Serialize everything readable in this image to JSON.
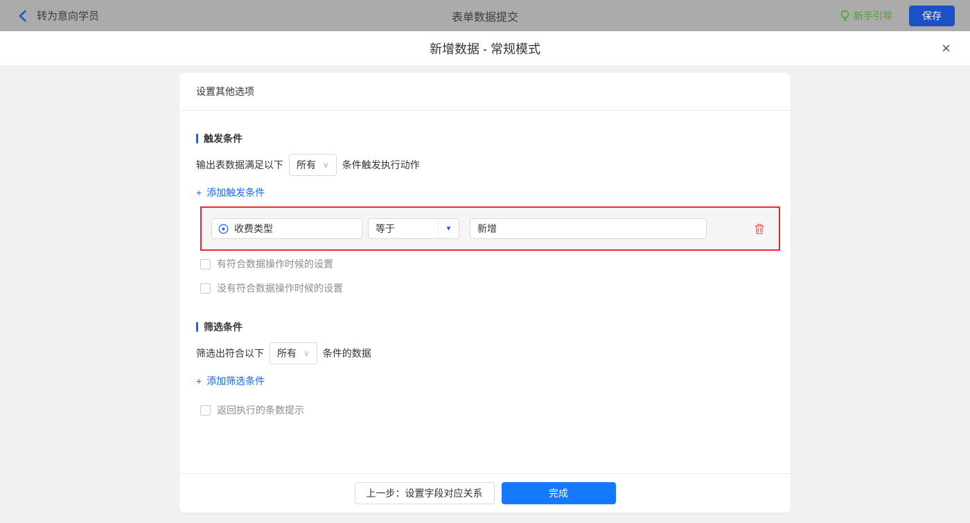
{
  "topbar": {
    "back_label": "转为意向学员",
    "title": "表单数据提交",
    "guide_label": "新手引导",
    "save_label": "保存"
  },
  "modal": {
    "title": "新增数据 - 常规模式"
  },
  "icons": {
    "close": "×",
    "plus": "+",
    "select_chevron": "∨",
    "operator_caret": "▼"
  },
  "card": {
    "header": "设置其他选项",
    "trigger": {
      "title": "触发条件",
      "prefix": "输出表数据满足以下",
      "match_mode": "所有",
      "suffix": "条件触发执行动作",
      "add_label": "添加触发条件",
      "condition": {
        "field": "收费类型",
        "operator": "等于",
        "value": "新增"
      },
      "checkbox_has_match": "有符合数据操作时候的设置",
      "checkbox_no_match": "没有符合数据操作时候的设置"
    },
    "filter": {
      "title": "筛选条件",
      "prefix": "筛选出符合以下",
      "match_mode": "所有",
      "suffix": "条件的数据",
      "add_label": "添加筛选条件",
      "checkbox_count_tip": "返回执行的条数提示"
    },
    "footer": {
      "prev_label": "上一步：设置字段对应关系",
      "done_label": "完成"
    }
  },
  "colors": {
    "primary_blue": "#1677ff",
    "link_blue": "#1667ff",
    "highlight_red": "#f5222d",
    "guide_green": "#4ba32b",
    "dimmed_bar": "#ababab",
    "trash_red": "#f56060"
  }
}
